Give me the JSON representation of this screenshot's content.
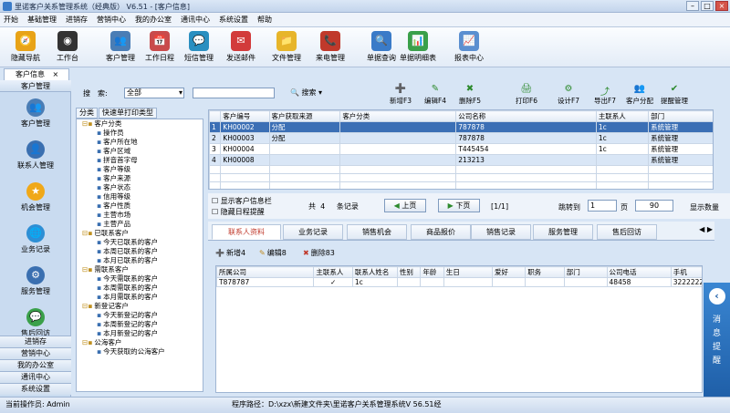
{
  "window": {
    "title": "里诺客户关系管理系统（经典版） V6.51 - [客户信息]"
  },
  "menu": [
    "开始",
    "基础管理",
    "进销存",
    "营销中心",
    "我的办公室",
    "通讯中心",
    "系统设置",
    "帮助"
  ],
  "toolbar": [
    {
      "label": "隐藏导航",
      "icon": "compass-icon",
      "color": "#e8a317"
    },
    {
      "label": "工作台",
      "icon": "camera-icon",
      "color": "#333333"
    },
    {
      "label": "客户管理",
      "icon": "users-icon",
      "color": "#4a7db5"
    },
    {
      "label": "工作日程",
      "icon": "calendar-icon",
      "color": "#c94b4b"
    },
    {
      "label": "短信管理",
      "icon": "sms-icon",
      "color": "#2a8fc0"
    },
    {
      "label": "发送邮件",
      "icon": "mail-icon",
      "color": "#d23b3b"
    },
    {
      "label": "文件管理",
      "icon": "folder-icon",
      "color": "#e7b52a"
    },
    {
      "label": "来电管理",
      "icon": "phone-icon",
      "color": "#c0392b"
    },
    {
      "label": "单据查询",
      "icon": "magnifier-icon",
      "color": "#3a7bc8"
    },
    {
      "label": "单据明细表",
      "icon": "barchart-icon",
      "color": "#3aa04a"
    },
    {
      "label": "报表中心",
      "icon": "report-icon",
      "color": "#5b8fd0"
    }
  ],
  "doc_tab": "客户信息",
  "left_nav": {
    "header": "客户管理",
    "items": [
      {
        "label": "客户管理",
        "icon": "users-icon",
        "color": "#4a7db5"
      },
      {
        "label": "联系人管理",
        "icon": "contact-icon",
        "color": "#3a6fb0"
      },
      {
        "label": "机会管理",
        "icon": "star-icon",
        "color": "#f0a818"
      },
      {
        "label": "业务记录",
        "icon": "globe-icon",
        "color": "#2d8fd5"
      },
      {
        "label": "服务管理",
        "icon": "service-icon",
        "color": "#3a6fb0"
      },
      {
        "label": "售后回访",
        "icon": "chat-icon",
        "color": "#3aa04a"
      }
    ],
    "bottom": [
      "进销存",
      "营销中心",
      "我的办公室",
      "通讯中心",
      "系统设置"
    ]
  },
  "search": {
    "field_label": "搜　索:",
    "field_value": "全部",
    "button": "搜索"
  },
  "tree_tabs": [
    "分类",
    "快速单打印类型"
  ],
  "tree": [
    "客户分类",
    "操作员",
    "客户所在地",
    "客户区域",
    "拼音首字母",
    "客户等级",
    "客户来源",
    "客户状态",
    "信用等级",
    "客户性质",
    "主营市场",
    "主营产品",
    "已联系客户",
    "今天已联系的客户",
    "本周已联系的客户",
    "本月已联系的客户",
    "需联系客户",
    "今天需联系的客户",
    "本周需联系的客户",
    "本月需联系的客户",
    "新登记客户",
    "今天新登记的客户",
    "本周新登记的客户",
    "本月新登记的客户",
    "公海客户",
    "今天获取的公海客户"
  ],
  "actions": [
    "新增F3",
    "编辑F4",
    "删除F5",
    "打印F6",
    "设计F7",
    "导出F7",
    "客户分配",
    "提醒管理"
  ],
  "grid": {
    "columns": [
      "客户编号",
      "客户获取来源",
      "客户分类",
      "公司名称",
      "主联系人",
      "部门"
    ],
    "rows": [
      [
        "KH00002",
        "分配",
        "",
        "787878",
        "1c",
        "系统管理"
      ],
      [
        "KH00003",
        "分配",
        "",
        "787878",
        "1c",
        "系统管理"
      ],
      [
        "KH00004",
        "",
        "",
        "T445454",
        "1c",
        "系统管理"
      ],
      [
        "KH00008",
        "",
        "",
        "213213",
        "",
        "系统管理"
      ]
    ]
  },
  "pager": {
    "show_info": "显示客户信息栏",
    "hide_schedule": "隐藏日程提醒",
    "total_prefix": "共",
    "total": "4",
    "total_suffix": "条记录",
    "prev": "上页",
    "next": "下页",
    "page": "[1/1]",
    "jump": "跳转到",
    "page_input": "1",
    "page_unit": "页",
    "page_size": "90",
    "display_count": "显示数量"
  },
  "subtabs": [
    "联系人资料",
    "业务记录",
    "销售机会",
    "商品报价",
    "销售记录",
    "服务管理",
    "售后回访"
  ],
  "contact_actions": [
    "新增4",
    "编辑8",
    "删除83"
  ],
  "contact_table": {
    "columns": [
      "所属公司",
      "主联系人",
      "联系人姓名",
      "性别",
      "年龄",
      "生日",
      "爱好",
      "职务",
      "部门",
      "公司电话",
      "手机"
    ],
    "rows": [
      [
        "T878787",
        "✓",
        "1c",
        "",
        "",
        "",
        "",
        "",
        "",
        "48458",
        "32222222222"
      ]
    ]
  },
  "side_panel": "消息提醒",
  "status": {
    "operator": "当前操作员: Admin",
    "path": "程序路径：D:\\xzx\\新建文件夹\\里诺客户关系管理系统V 56.51经"
  }
}
